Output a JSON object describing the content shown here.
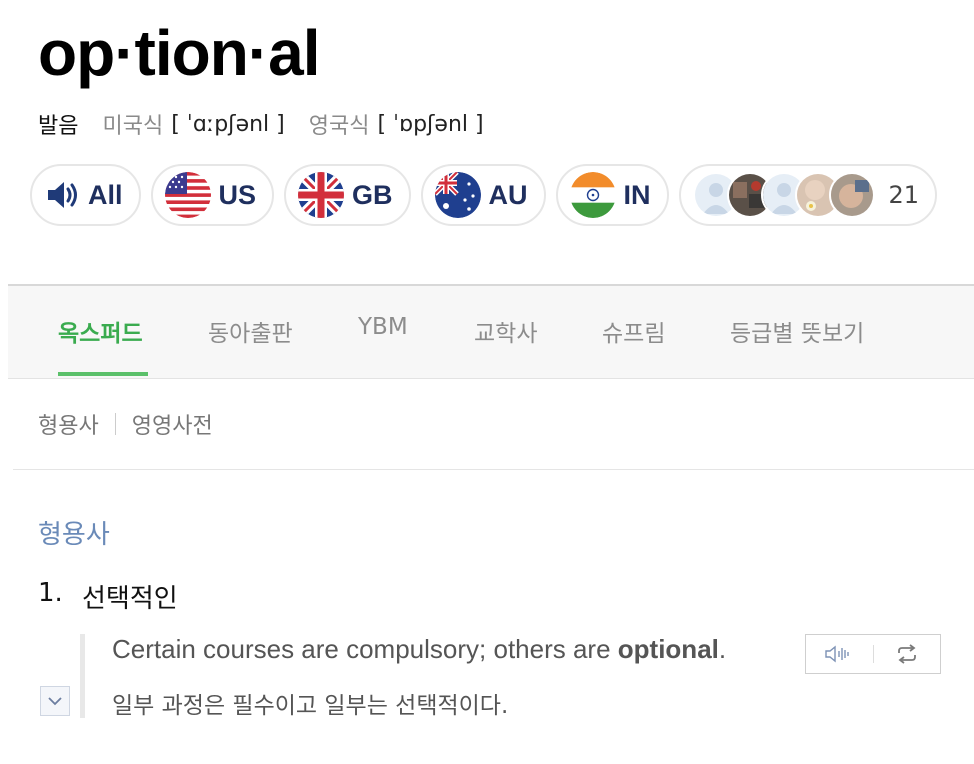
{
  "entry": {
    "headword": "op·tion·al",
    "pronunciation_label": "발음",
    "pronunciations": [
      {
        "region": "미국식",
        "ipa": "[ ˈɑːpʃənl ]"
      },
      {
        "region": "영국식",
        "ipa": "[ ˈɒpʃənl ]"
      }
    ]
  },
  "audio": {
    "buttons": [
      {
        "label": "All",
        "icon": "speaker-icon"
      },
      {
        "label": "US",
        "icon": "us-flag-icon"
      },
      {
        "label": "GB",
        "icon": "gb-flag-icon"
      },
      {
        "label": "AU",
        "icon": "au-flag-icon"
      },
      {
        "label": "IN",
        "icon": "in-flag-icon"
      }
    ],
    "user_count": "21"
  },
  "tabs": [
    {
      "label": "옥스퍼드",
      "active": true
    },
    {
      "label": "동아출판",
      "active": false
    },
    {
      "label": "YBM",
      "active": false
    },
    {
      "label": "교학사",
      "active": false
    },
    {
      "label": "슈프림",
      "active": false
    },
    {
      "label": "등급별 뜻보기",
      "active": false
    }
  ],
  "subnav": [
    "형용사",
    "영영사전"
  ],
  "definition": {
    "pos": "형용사",
    "senses": [
      {
        "number": "1.",
        "meaning": "선택적인",
        "example": {
          "en_before": "Certain courses are compulsory; others are ",
          "en_highlight": "optional",
          "en_after": ".",
          "ko": "일부 과정은 필수이고 일부는 선택적이다."
        }
      }
    ]
  },
  "colors": {
    "active_tab": "#3aab4f",
    "pos": "#6a8ab8",
    "pill_text": "#1f2f5e"
  }
}
